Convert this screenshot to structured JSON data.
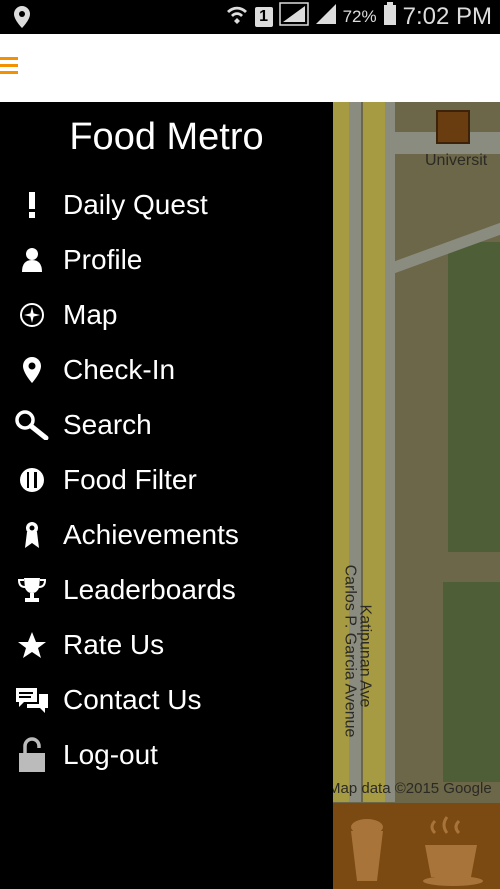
{
  "status_bar": {
    "sim_badge": "1",
    "battery": "72%",
    "time": "7:02 PM"
  },
  "drawer": {
    "title": "Food Metro",
    "items": [
      {
        "label": "Daily Quest",
        "icon": "exclamation-icon"
      },
      {
        "label": "Profile",
        "icon": "person-icon"
      },
      {
        "label": "Map",
        "icon": "compass-icon"
      },
      {
        "label": "Check-In",
        "icon": "location-pin-icon"
      },
      {
        "label": "Search",
        "icon": "magnifier-icon"
      },
      {
        "label": "Food Filter",
        "icon": "fork-knife-icon"
      },
      {
        "label": "Achievements",
        "icon": "ribbon-icon"
      },
      {
        "label": "Leaderboards",
        "icon": "trophy-icon"
      },
      {
        "label": "Rate Us",
        "icon": "star-icon"
      },
      {
        "label": "Contact Us",
        "icon": "chat-bubbles-icon"
      },
      {
        "label": "Log-out",
        "icon": "lock-icon"
      }
    ]
  },
  "map": {
    "street_university": "Universit",
    "street_garcia": "Carlos P. Garcia Avenue",
    "street_katipunan": "Katipunan Ave",
    "attribution": "Map data ©2015 Google"
  },
  "colors": {
    "accent": "#f39200",
    "drawer_bg": "#000000"
  }
}
